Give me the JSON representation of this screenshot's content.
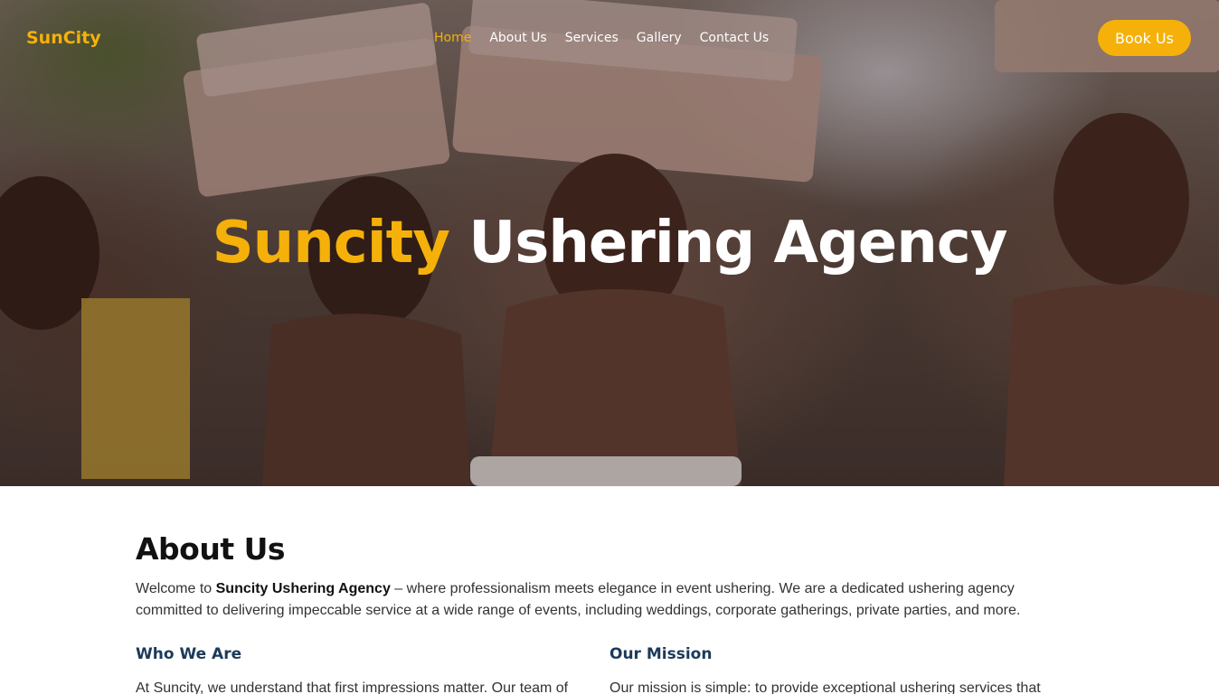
{
  "nav": {
    "logo": "SunCity",
    "items": [
      {
        "label": "Home",
        "active": true
      },
      {
        "label": "About Us",
        "active": false
      },
      {
        "label": "Services",
        "active": false
      },
      {
        "label": "Gallery",
        "active": false
      },
      {
        "label": "Contact Us",
        "active": false
      }
    ],
    "cta": "Book Us"
  },
  "hero": {
    "title_accent": "Suncity",
    "title_rest": "Ushering Agency"
  },
  "about": {
    "heading": "About Us",
    "intro_prefix": "Welcome to ",
    "intro_bold": "Suncity Ushering Agency",
    "intro_suffix": " – where professionalism meets elegance in event ushering. We are a dedicated ushering agency committed to delivering impeccable service at a wide range of events, including weddings, corporate gatherings, private parties, and more.",
    "who": {
      "heading": "Who We Are",
      "text": "At Suncity, we understand that first impressions matter. Our team of"
    },
    "mission": {
      "heading": "Our Mission",
      "text": "Our mission is simple: to provide exceptional ushering services that"
    }
  },
  "colors": {
    "accent": "#f5b10a",
    "subheading": "#1b3a5a"
  }
}
